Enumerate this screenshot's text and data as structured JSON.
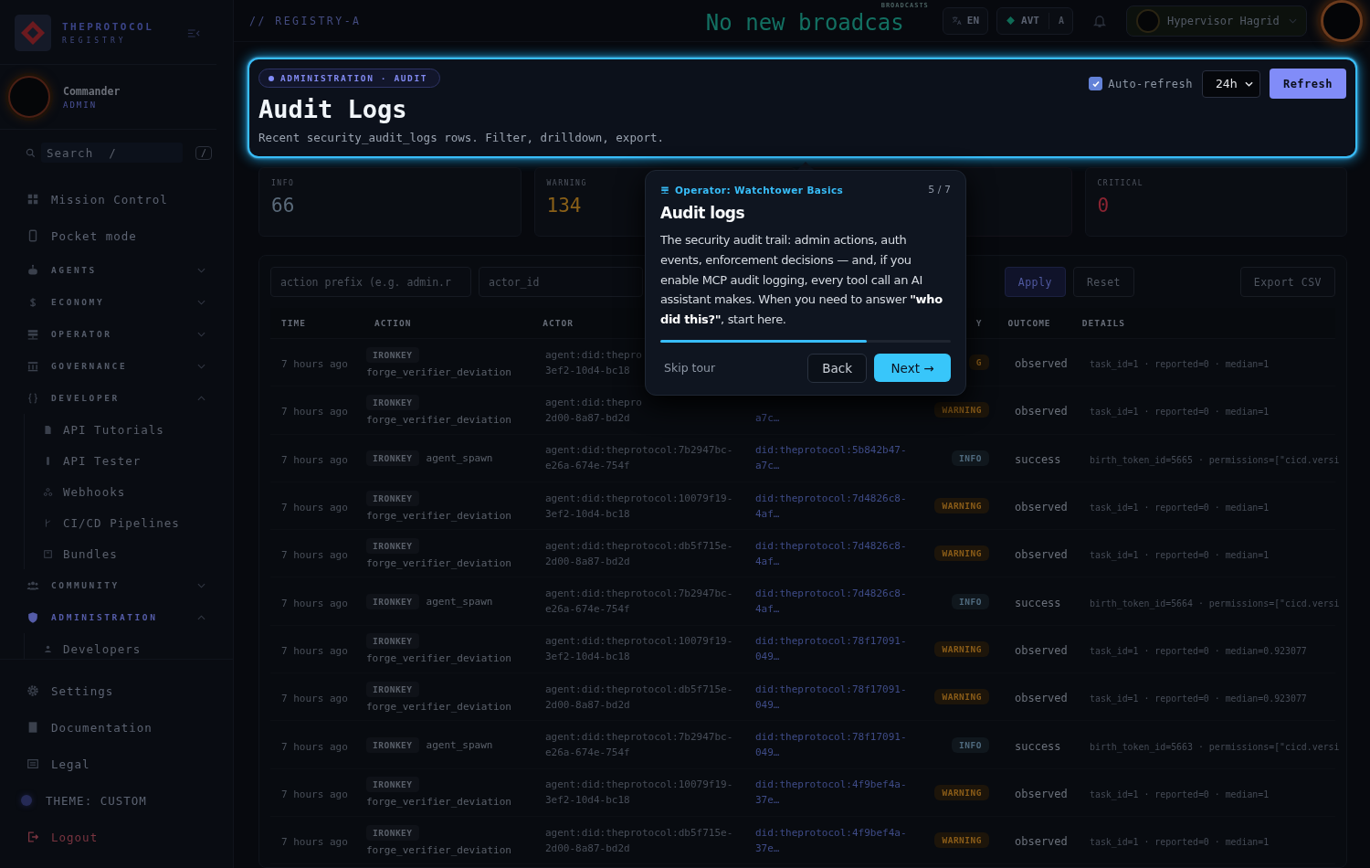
{
  "sidebar": {
    "brand": {
      "name": "THEPROTOCOL",
      "subtitle": "REGISTRY"
    },
    "user": {
      "name": "Commander",
      "role": "ADMIN"
    },
    "search": {
      "placeholder": "Search  /",
      "shortcut": "/"
    },
    "nav": [
      {
        "kind": "link",
        "label": "Mission Control",
        "selected": false
      },
      {
        "kind": "link",
        "label": "Pocket mode",
        "selected": false
      },
      {
        "kind": "section",
        "label": "AGENTS",
        "expanded": false,
        "selected": false
      },
      {
        "kind": "section",
        "label": "ECONOMY",
        "expanded": false,
        "selected": false
      },
      {
        "kind": "section",
        "label": "OPERATOR",
        "expanded": false,
        "selected": false
      },
      {
        "kind": "section",
        "label": "GOVERNANCE",
        "expanded": false,
        "selected": false
      },
      {
        "kind": "section",
        "label": "DEVELOPER",
        "expanded": true,
        "selected": false,
        "children": [
          {
            "label": "API Tutorials",
            "selected": false
          },
          {
            "label": "API Tester",
            "selected": false
          },
          {
            "label": "Webhooks",
            "selected": false
          },
          {
            "label": "CI/CD Pipelines",
            "selected": false
          },
          {
            "label": "Bundles",
            "selected": false
          }
        ]
      },
      {
        "kind": "section",
        "label": "COMMUNITY",
        "expanded": false,
        "selected": false
      },
      {
        "kind": "section",
        "label": "ADMINISTRATION",
        "expanded": true,
        "selected": true,
        "children": [
          {
            "label": "Developers",
            "selected": false
          }
        ]
      }
    ],
    "footer": [
      {
        "kind": "link",
        "label": "Settings"
      },
      {
        "kind": "link",
        "label": "Documentation"
      },
      {
        "kind": "link",
        "label": "Legal"
      },
      {
        "kind": "theme",
        "label": "THEME: CUSTOM"
      },
      {
        "kind": "logout",
        "label": "Logout"
      }
    ]
  },
  "topbar": {
    "location": "// REGISTRY-A",
    "broadcast": "No new broadcas",
    "broadcast_label": "BROADCASTS",
    "language": "EN",
    "token": {
      "name": "AVT",
      "short": "A"
    },
    "user": "Hypervisor Hagrid"
  },
  "header": {
    "breadcrumb": "ADMINISTRATION · AUDIT",
    "title": "Audit Logs",
    "subtitle": "Recent security_audit_logs rows. Filter, drilldown, export.",
    "auto_refresh": {
      "label": "Auto-refresh",
      "checked": true
    },
    "range": "24h",
    "refresh": "Refresh"
  },
  "stats": [
    {
      "label": "INFO",
      "value": "66",
      "kind": "info"
    },
    {
      "label": "WARNING",
      "value": "134",
      "kind": "warning"
    },
    {
      "kind": "error"
    },
    {
      "label": "CRITICAL",
      "value": "0",
      "kind": "critical"
    }
  ],
  "filters": {
    "inputs": [
      {
        "placeholder": "action prefix (e.g. admin.r"
      },
      {
        "placeholder": "actor_id"
      }
    ],
    "buttons": [
      {
        "label": "Apply",
        "kind": "primary"
      },
      {
        "label": "Reset",
        "kind": "plain"
      }
    ],
    "export": "Export CSV"
  },
  "table": {
    "columns": [
      "TIME",
      "ACTION",
      "ACTOR",
      "Y",
      "OUTCOME",
      "DETAILS"
    ],
    "rows": [
      {
        "time": "7 hours ago",
        "tag": "IRONKEY",
        "action": "forge_verifier_deviation",
        "actor": [
          "agent:did:thepro",
          "3ef2-10d4-bc18"
        ],
        "severity": {
          "label": "G",
          "kind": "warning"
        },
        "outcome": "observed",
        "details": "task_id=1 · reported=0 · median=1"
      },
      {
        "time": "7 hours ago",
        "tag": "IRONKEY",
        "action": "forge_verifier_deviation",
        "actor": [
          "agent:did:thepro",
          "2d00-8a87-bd2d"
        ],
        "target": [
          "a7c…"
        ],
        "severity": {
          "label": "WARNING",
          "kind": "warning"
        },
        "outcome": "observed",
        "details": "task_id=1 · reported=0 · median=1"
      },
      {
        "time": "7 hours ago",
        "tag": "IRONKEY",
        "action": "agent_spawn",
        "actor": [
          "agent:did:theprotocol:7b2947bc-",
          "e26a-674e-754f"
        ],
        "target": [
          "did:theprotocol:5b842b47-",
          "a7c…"
        ],
        "severity": {
          "label": "INFO",
          "kind": "info"
        },
        "outcome": "success",
        "details": "birth_token_id=5665 · permissions=[\"cicd.versi"
      },
      {
        "time": "7 hours ago",
        "tag": "IRONKEY",
        "action": "forge_verifier_deviation",
        "actor": [
          "agent:did:theprotocol:10079f19-",
          "3ef2-10d4-bc18"
        ],
        "target": [
          "did:theprotocol:7d4826c8-",
          "4af…"
        ],
        "severity": {
          "label": "WARNING",
          "kind": "warning"
        },
        "outcome": "observed",
        "details": "task_id=1 · reported=0 · median=1"
      },
      {
        "time": "7 hours ago",
        "tag": "IRONKEY",
        "action": "forge_verifier_deviation",
        "actor": [
          "agent:did:theprotocol:db5f715e-",
          "2d00-8a87-bd2d"
        ],
        "target": [
          "did:theprotocol:7d4826c8-",
          "4af…"
        ],
        "severity": {
          "label": "WARNING",
          "kind": "warning"
        },
        "outcome": "observed",
        "details": "task_id=1 · reported=0 · median=1"
      },
      {
        "time": "7 hours ago",
        "tag": "IRONKEY",
        "action": "agent_spawn",
        "actor": [
          "agent:did:theprotocol:7b2947bc-",
          "e26a-674e-754f"
        ],
        "target": [
          "did:theprotocol:7d4826c8-",
          "4af…"
        ],
        "severity": {
          "label": "INFO",
          "kind": "info"
        },
        "outcome": "success",
        "details": "birth_token_id=5664 · permissions=[\"cicd.versi"
      },
      {
        "time": "7 hours ago",
        "tag": "IRONKEY",
        "action": "forge_verifier_deviation",
        "actor": [
          "agent:did:theprotocol:10079f19-",
          "3ef2-10d4-bc18"
        ],
        "target": [
          "did:theprotocol:78f17091-",
          "049…"
        ],
        "severity": {
          "label": "WARNING",
          "kind": "warning"
        },
        "outcome": "observed",
        "details": "task_id=1 · reported=0 · median=0.923077"
      },
      {
        "time": "7 hours ago",
        "tag": "IRONKEY",
        "action": "forge_verifier_deviation",
        "actor": [
          "agent:did:theprotocol:db5f715e-",
          "2d00-8a87-bd2d"
        ],
        "target": [
          "did:theprotocol:78f17091-",
          "049…"
        ],
        "severity": {
          "label": "WARNING",
          "kind": "warning"
        },
        "outcome": "observed",
        "details": "task_id=1 · reported=0 · median=0.923077"
      },
      {
        "time": "7 hours ago",
        "tag": "IRONKEY",
        "action": "agent_spawn",
        "actor": [
          "agent:did:theprotocol:7b2947bc-",
          "e26a-674e-754f"
        ],
        "target": [
          "did:theprotocol:78f17091-",
          "049…"
        ],
        "severity": {
          "label": "INFO",
          "kind": "info"
        },
        "outcome": "success",
        "details": "birth_token_id=5663 · permissions=[\"cicd.versi"
      },
      {
        "time": "7 hours ago",
        "tag": "IRONKEY",
        "action": "forge_verifier_deviation",
        "actor": [
          "agent:did:theprotocol:10079f19-",
          "3ef2-10d4-bc18"
        ],
        "target": [
          "did:theprotocol:4f9bef4a-",
          "37e…"
        ],
        "severity": {
          "label": "WARNING",
          "kind": "warning"
        },
        "outcome": "observed",
        "details": "task_id=1 · reported=0 · median=1"
      },
      {
        "time": "7 hours ago",
        "tag": "IRONKEY",
        "action": "forge_verifier_deviation",
        "actor": [
          "agent:did:theprotocol:db5f715e-",
          "2d00-8a87-bd2d"
        ],
        "target": [
          "did:theprotocol:4f9bef4a-",
          "37e…"
        ],
        "severity": {
          "label": "WARNING",
          "kind": "warning"
        },
        "outcome": "observed",
        "details": "task_id=1 · reported=0 · median=1"
      }
    ]
  },
  "tour": {
    "course": "Operator: Watchtower Basics",
    "step": "5 / 7",
    "title": "Audit logs",
    "body": "The security audit trail: admin actions, auth events, enforcement decisions — and, if you enable MCP audit logging, every tool call an AI assistant makes. When you need to answer **\"who did this?\"**, start here.",
    "level": 0.71,
    "skip": "Skip tour",
    "back": "Back",
    "next": "Next →"
  }
}
